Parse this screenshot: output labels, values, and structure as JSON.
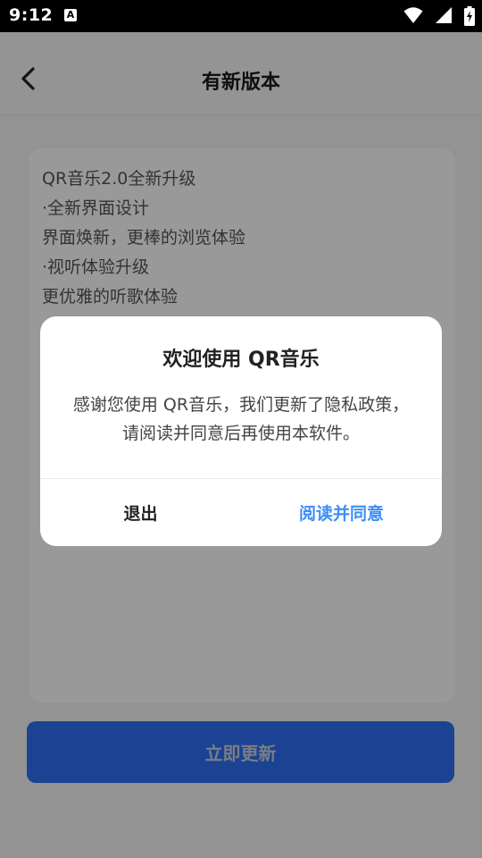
{
  "status_bar": {
    "time": "9:12",
    "notification_icon_letter": "A",
    "icons": [
      "wifi-icon",
      "signal-icon",
      "battery-icon"
    ]
  },
  "app_bar": {
    "title": "有新版本",
    "back_icon": "chevron-left-icon"
  },
  "release_notes": [
    "QR音乐2.0全新升级",
    "·全新界面设计",
    "界面焕新，更棒的浏览体验",
    "·视听体验升级",
    "更优雅的听歌体验"
  ],
  "update_button": {
    "label": "立即更新",
    "color": "#2f6ff5"
  },
  "dialog": {
    "title": "欢迎使用 QR音乐",
    "message": "感谢您使用 QR音乐，我们更新了隐私政策，请阅读并同意后再使用本软件。",
    "exit_label": "退出",
    "agree_label": "阅读并同意",
    "agree_color": "#3c8ef6"
  }
}
